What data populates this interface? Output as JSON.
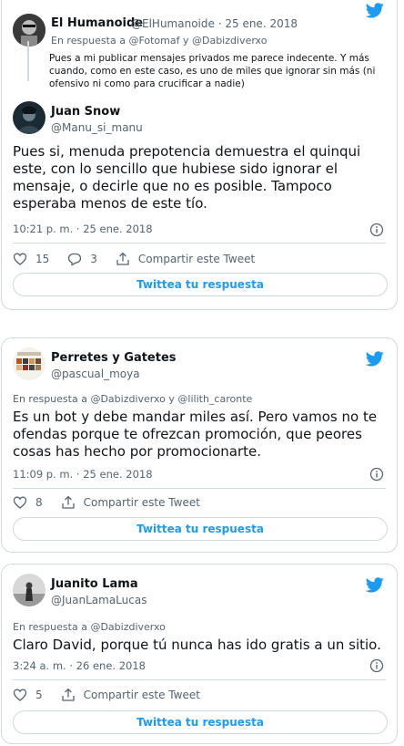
{
  "tweets": [
    {
      "quoted_name": "El Humanoide",
      "quoted_handle": "@ElHumanoide",
      "quoted_date": "25 ene. 2018",
      "quoted_reply_prefix": "En respuesta a",
      "quoted_reply_to": "@Fotomaf y @Dabizdiverxo",
      "quoted_text": "Pues a mi publicar mensajes privados me parece indecente. Y más cuando, como en este caso, es uno de miles que ignorar sin más (ni ofensivo ni como para crucificar a nadie)",
      "name": "Juan Snow",
      "handle": "@Manu_si_manu",
      "text": "Pues si, menuda prepotencia demuestra el quinqui este, con lo sencillo que hubiese sido ignorar el mensaje, o decirle que no es posible. Tampoco esperaba menos de este tío.",
      "time": "10:21 p. m. · 25 ene. 2018",
      "likes": "15",
      "replies": "3",
      "share": "Compartir este Tweet",
      "reply_button": "Twittea tu respuesta"
    },
    {
      "name": "Perretes y Gatetes",
      "handle": "@pascual_moya",
      "reply_line": "En respuesta a @Dabizdiverxo y @lilith_caronte",
      "text": "Es un bot y debe mandar miles así.  Pero vamos no te ofendas porque te ofrezcan promoción, que peores cosas has hecho por promocionarte.",
      "time": "11:09 p. m. · 25 ene. 2018",
      "likes": "8",
      "share": "Compartir este Tweet",
      "reply_button": "Twittea tu respuesta"
    },
    {
      "name": "Juanito Lama",
      "handle": "@JuanLamaLucas",
      "reply_line": "En respuesta a @Dabizdiverxo",
      "text": "Claro David, porque tú nunca has ido gratis a un sitio.",
      "time": "3:24 a. m. · 26 ene. 2018",
      "likes": "5",
      "share": "Compartir este Tweet",
      "reply_button": "Twittea tu respuesta"
    }
  ],
  "colors": {
    "accent": "#1d9bf0",
    "muted": "#536471",
    "border": "#cfd9de"
  },
  "icons": [
    "twitter-bird-icon",
    "heart-icon",
    "reply-icon",
    "share-icon",
    "info-icon"
  ]
}
